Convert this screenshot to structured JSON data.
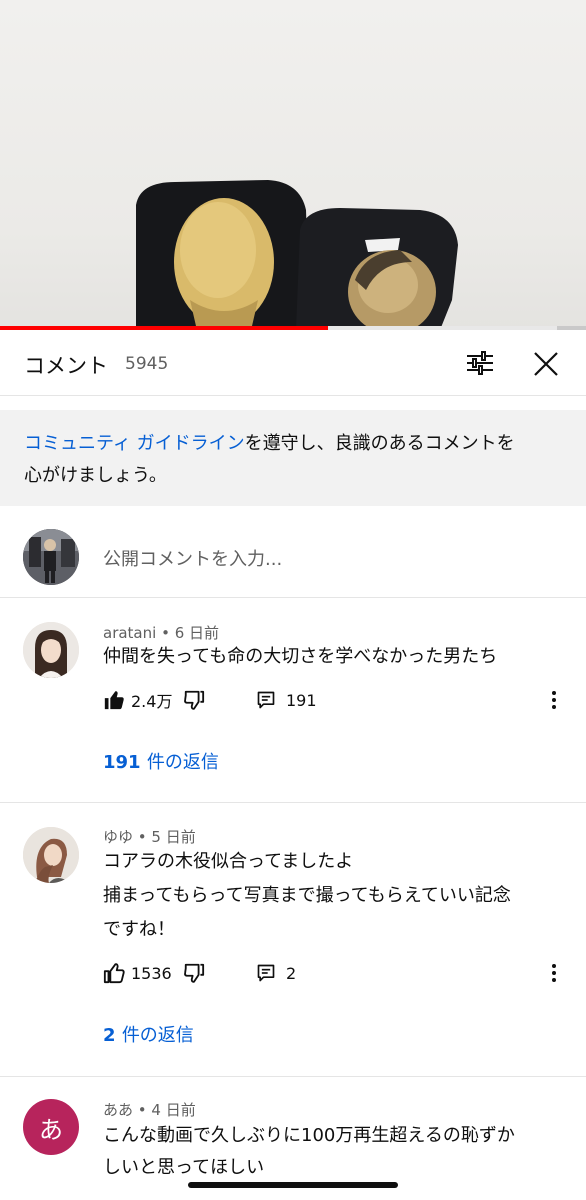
{
  "video": {
    "progress_fraction": 0.56,
    "buffer_fraction": 0.95
  },
  "header": {
    "title": "コメント",
    "count": "5945",
    "filter_icon": "tune-icon",
    "close_icon": "close-icon"
  },
  "notice": {
    "link_text": "コミュニティ ガイドライン",
    "text_line1_rest": "を遵守し、良識のあるコメントを",
    "text_line2": "心がけましょう。"
  },
  "input": {
    "placeholder": "公開コメントを入力..."
  },
  "comments": [
    {
      "author": "aratani",
      "age": "6 日前",
      "lines": [
        "仲間を失っても命の大切さを学べなかった男たち"
      ],
      "likes": "2.4万",
      "liked": true,
      "reply_count": "191",
      "replies_num": "191",
      "replies_suffix": "件の返信"
    },
    {
      "author": "ゆゆ",
      "age": "5 日前",
      "lines": [
        "コアラの木役似合ってましたよ",
        "捕まってもらって写真まで撮ってもらえていい記念",
        "ですね！"
      ],
      "likes": "1536",
      "liked": false,
      "reply_count": "2",
      "replies_num": "2",
      "replies_suffix": "件の返信"
    },
    {
      "author": "ああ",
      "age": "4 日前",
      "avatar_letter": "あ",
      "avatar_color": "#b7245c",
      "lines": [
        "こんな動画で久しぶりに100万再生超えるの恥ずか",
        "しいと思ってほしい"
      ]
    }
  ],
  "colors": {
    "accent_blue": "#065fd4",
    "progress_red": "#ff0000",
    "secondary_text": "#606060"
  }
}
